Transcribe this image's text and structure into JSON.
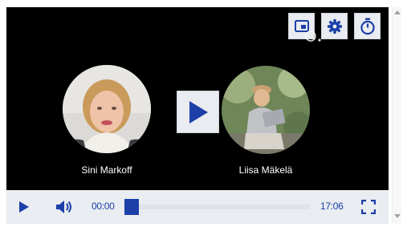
{
  "player": {
    "speakers": [
      {
        "name": "Sini Markoff"
      },
      {
        "name": "Liisa Mäkelä"
      }
    ],
    "top_controls": [
      "picture-in-picture",
      "settings",
      "timer"
    ],
    "controls": {
      "current_time": "00:00",
      "duration": "17:06",
      "progress": 0
    },
    "colors": {
      "accent": "#1c3fa8",
      "button_bg": "#e9ecf0",
      "video_bg": "#000000"
    }
  }
}
